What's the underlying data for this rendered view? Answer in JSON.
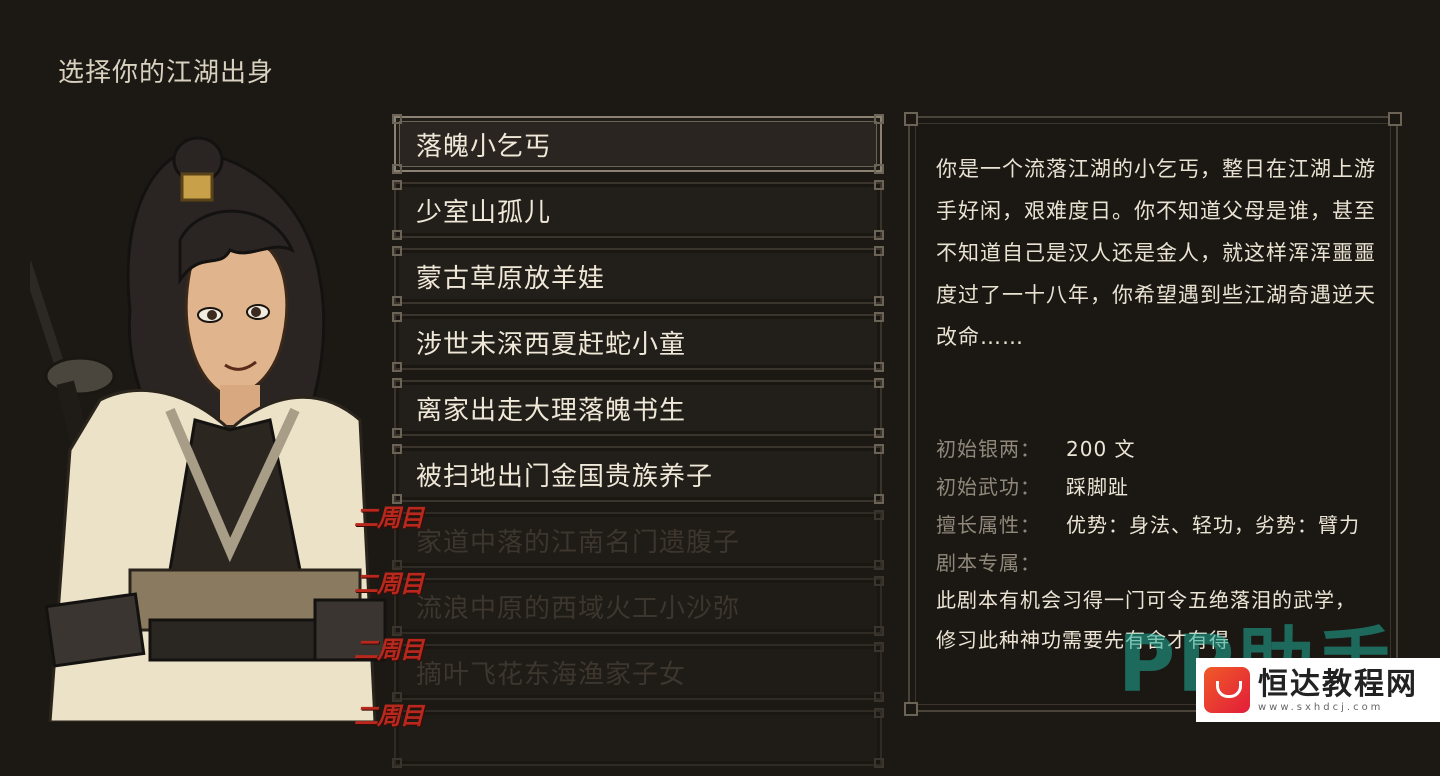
{
  "page_title": "选择你的江湖出身",
  "origins": [
    {
      "label": "落魄小乞丐",
      "state": "selected",
      "tag": ""
    },
    {
      "label": "少室山孤儿",
      "state": "available",
      "tag": ""
    },
    {
      "label": "蒙古草原放羊娃",
      "state": "available",
      "tag": ""
    },
    {
      "label": "涉世未深西夏赶蛇小童",
      "state": "available",
      "tag": ""
    },
    {
      "label": "离家出走大理落魄书生",
      "state": "available",
      "tag": ""
    },
    {
      "label": "被扫地出门金国贵族养子",
      "state": "available",
      "tag": ""
    },
    {
      "label": "家道中落的江南名门遗腹子",
      "state": "locked",
      "tag": "二周目"
    },
    {
      "label": "流浪中原的西域火工小沙弥",
      "state": "locked",
      "tag": "二周目"
    },
    {
      "label": "摘叶飞花东海渔家子女",
      "state": "locked",
      "tag": "二周目"
    },
    {
      "label": "",
      "state": "locked",
      "tag": "二周目"
    }
  ],
  "detail": {
    "description": "你是一个流落江湖的小乞丐，整日在江湖上游手好闲，艰难度日。你不知道父母是谁，甚至不知道自己是汉人还是金人，就这样浑浑噩噩度过了一十八年，你希望遇到些江湖奇遇逆天改命……",
    "stats": [
      {
        "label": "初始银两：",
        "value": "200 文"
      },
      {
        "label": "初始武功：",
        "value": "踩脚趾"
      },
      {
        "label": "擅长属性：",
        "value": "优势：身法、轻功，劣势：臂力"
      },
      {
        "label": "剧本专属：",
        "value": ""
      }
    ],
    "exclusive_text": "此剧本有机会习得一门可令五绝落泪的武学，修习此种神功需要先有舍才有得"
  },
  "watermark": {
    "pp_text": "PP助手",
    "site_title": "恒达教程网",
    "site_url": "www.sxhdcj.com"
  },
  "colors": {
    "background": "#1c1915",
    "lock_tag": "#b8281c",
    "watermark_teal": "#1fae9a"
  }
}
